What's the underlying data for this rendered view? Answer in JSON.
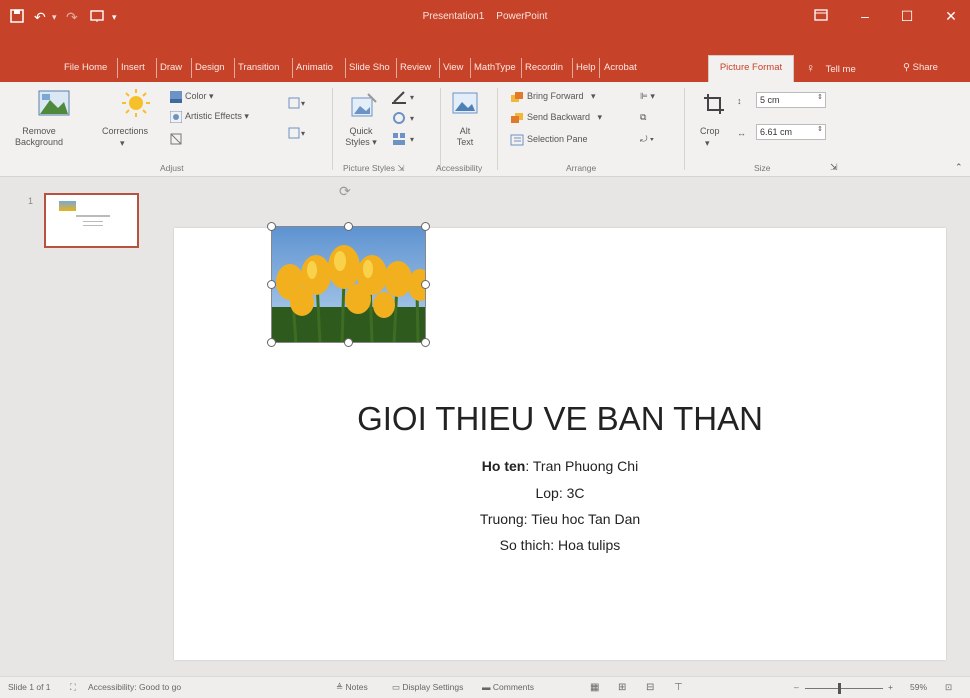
{
  "titlebar": {
    "document_name": "Presentation1",
    "app_name": "PowerPoint"
  },
  "tabs": [
    "File",
    "Home",
    "Insert",
    "Draw",
    "Design",
    "Transition",
    "Animatio",
    "Slide Sho",
    "Review",
    "View",
    "MathType",
    "Recordin",
    "Help",
    "Acrobat"
  ],
  "active_tab": "Picture Format",
  "tell_me": "Tell me",
  "share": "Share",
  "ribbon": {
    "remove_background": [
      "Remove",
      "Background"
    ],
    "corrections": "Corrections",
    "color": "Color",
    "artistic_effects": "Artistic Effects",
    "adjust_label": "Adjust",
    "quick_styles": [
      "Quick",
      "Styles"
    ],
    "picture_styles_label": "Picture Styles",
    "alt_text": [
      "Alt",
      "Text"
    ],
    "accessibility_label": "Accessibility",
    "bring_forward": "Bring Forward",
    "send_backward": "Send Backward",
    "selection_pane": "Selection Pane",
    "arrange_label": "Arrange",
    "crop": "Crop",
    "height_value": "5 cm",
    "width_value": "6.61 cm",
    "size_label": "Size"
  },
  "slide_panel": {
    "slide_number": "1"
  },
  "slide": {
    "title": "GIOI THIEU VE BAN THAN",
    "lines": [
      {
        "label": "Ho ten",
        "value": ": Tran Phuong Chi"
      },
      {
        "label": "Lop",
        "value": ": 3C"
      },
      {
        "label": "Truong",
        "value": ": Tieu hoc Tan Dan"
      },
      {
        "label": "So thich",
        "value": ": Hoa tulips"
      }
    ]
  },
  "statusbar": {
    "slide_count": "Slide 1 of 1",
    "accessibility": "Accessibility: Good to go",
    "notes": "Notes",
    "display_settings": "Display Settings",
    "comments": "Comments",
    "zoom": "59%"
  },
  "colors": {
    "accent": "#c6432a",
    "ribbon_bg": "#f3f1ef"
  }
}
